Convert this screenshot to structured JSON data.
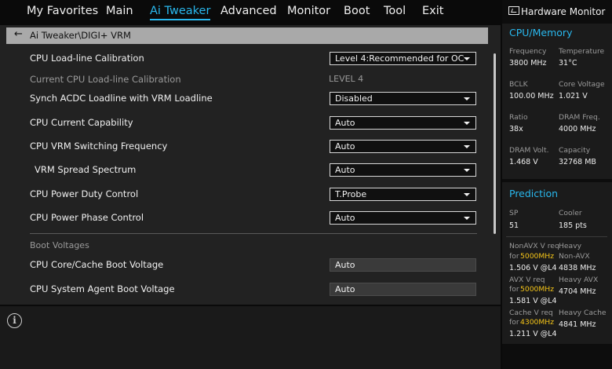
{
  "menu": {
    "tabs": [
      {
        "label": "My Favorites"
      },
      {
        "label": "Main"
      },
      {
        "label": "Ai Tweaker"
      },
      {
        "label": "Advanced"
      },
      {
        "label": "Monitor"
      },
      {
        "label": "Boot"
      },
      {
        "label": "Tool"
      },
      {
        "label": "Exit"
      }
    ],
    "active": "Ai Tweaker"
  },
  "breadcrumb": {
    "path": "Ai Tweaker\\DIGI+ VRM"
  },
  "settings": [
    {
      "label": "CPU Load-line Calibration",
      "value": "Level 4:Recommended for OC"
    },
    {
      "label": "Current CPU Load-line Calibration",
      "value": "LEVEL 4"
    },
    {
      "label": "Synch ACDC Loadline with VRM Loadline",
      "value": "Disabled"
    },
    {
      "label": "CPU Current Capability",
      "value": "Auto"
    },
    {
      "label": "CPU VRM Switching Frequency",
      "value": "Auto"
    },
    {
      "label": "VRM Spread Spectrum",
      "value": "Auto"
    },
    {
      "label": "CPU Power Duty Control",
      "value": "T.Probe"
    },
    {
      "label": "CPU Power Phase Control",
      "value": "Auto"
    }
  ],
  "boot_voltages": {
    "section": "Boot Voltages",
    "items": [
      {
        "label": "CPU Core/Cache Boot Voltage",
        "value": "Auto"
      },
      {
        "label": "CPU System Agent Boot Voltage",
        "value": "Auto"
      }
    ]
  },
  "hw": {
    "title": "Hardware Monitor",
    "cpu_mem": {
      "title": "CPU/Memory",
      "items": [
        {
          "label": "Frequency",
          "value": "3800 MHz"
        },
        {
          "label": "Temperature",
          "value": "31°C"
        },
        {
          "label": "BCLK",
          "value": "100.00 MHz"
        },
        {
          "label": "Core Voltage",
          "value": "1.021 V"
        },
        {
          "label": "Ratio",
          "value": "38x"
        },
        {
          "label": "DRAM Freq.",
          "value": "4000 MHz"
        },
        {
          "label": "DRAM Volt.",
          "value": "1.468 V"
        },
        {
          "label": "Capacity",
          "value": "32768 MB"
        }
      ]
    },
    "prediction": {
      "title": "Prediction",
      "sp_label": "SP",
      "sp_value": "51",
      "cooler_label": "Cooler",
      "cooler_value": "185 pts",
      "nonavx": {
        "label": "NonAVX V req",
        "for": "for",
        "freq": "5000MHz",
        "value": "1.506 V @L4",
        "heavy_label1": "Heavy",
        "heavy_label2": "Non-AVX",
        "heavy_value": "4838 MHz"
      },
      "avx": {
        "label": "AVX V req",
        "for": "for",
        "freq": "5000MHz",
        "value": "1.581 V @L4",
        "heavy_label": "Heavy AVX",
        "heavy_value": "4704 MHz"
      },
      "cache": {
        "label": "Cache V req",
        "for": "for",
        "freq": "4300MHz",
        "value": "1.211 V @L4",
        "heavy_label": "Heavy Cache",
        "heavy_value": "4841 MHz"
      }
    }
  },
  "colors": {
    "accent": "#29b8ee",
    "highlight": "#f5c518",
    "panel": "#222222"
  },
  "icons": {
    "back": "left-arrow-icon",
    "info": "info-icon",
    "monitor": "monitor-icon"
  }
}
